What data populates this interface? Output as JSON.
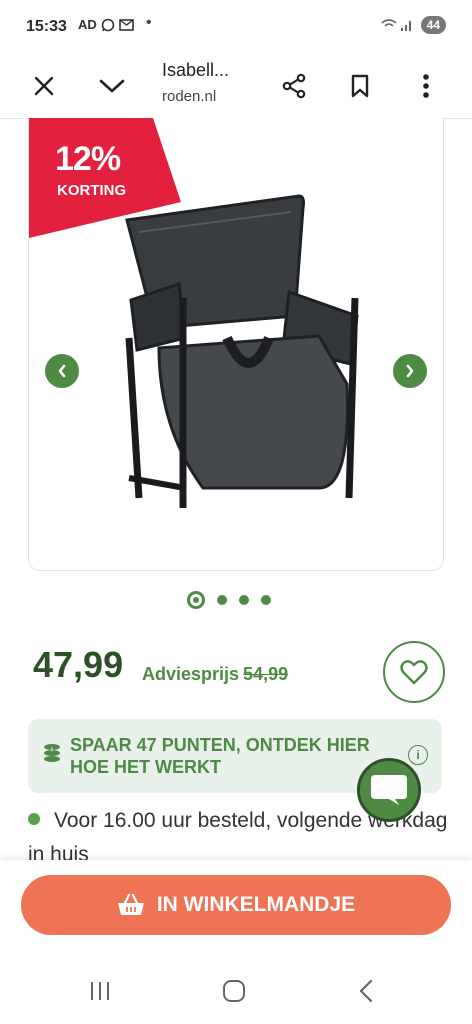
{
  "status_bar": {
    "time": "15:33",
    "notification_icons": [
      "ad-icon",
      "whatsapp-icon",
      "mail-icon"
    ],
    "dot": "•",
    "battery": "44"
  },
  "toolbar": {
    "title": "Isabell...",
    "domain": "roden.nl"
  },
  "product": {
    "discount_percent": "12%",
    "discount_label": "KORTING",
    "image_count": 4,
    "active_image": 1,
    "price": "47,99",
    "advies_label": "Adviesprijs",
    "advies_price": "54,99"
  },
  "points": {
    "text": "SPAAR 47 PUNTEN, ONTDEK HIER HOE HET WERKT",
    "info": "i"
  },
  "delivery": {
    "text": "Voor 16.00 uur besteld, volgende werkdag in huis"
  },
  "cart": {
    "label": "IN WINKELMANDJE"
  },
  "colors": {
    "brand_green": "#4f8a44",
    "dark_green": "#2e5028",
    "badge_red": "#e3203d",
    "cta_orange": "#ef7355",
    "banner_bg": "#e8f1ea"
  }
}
